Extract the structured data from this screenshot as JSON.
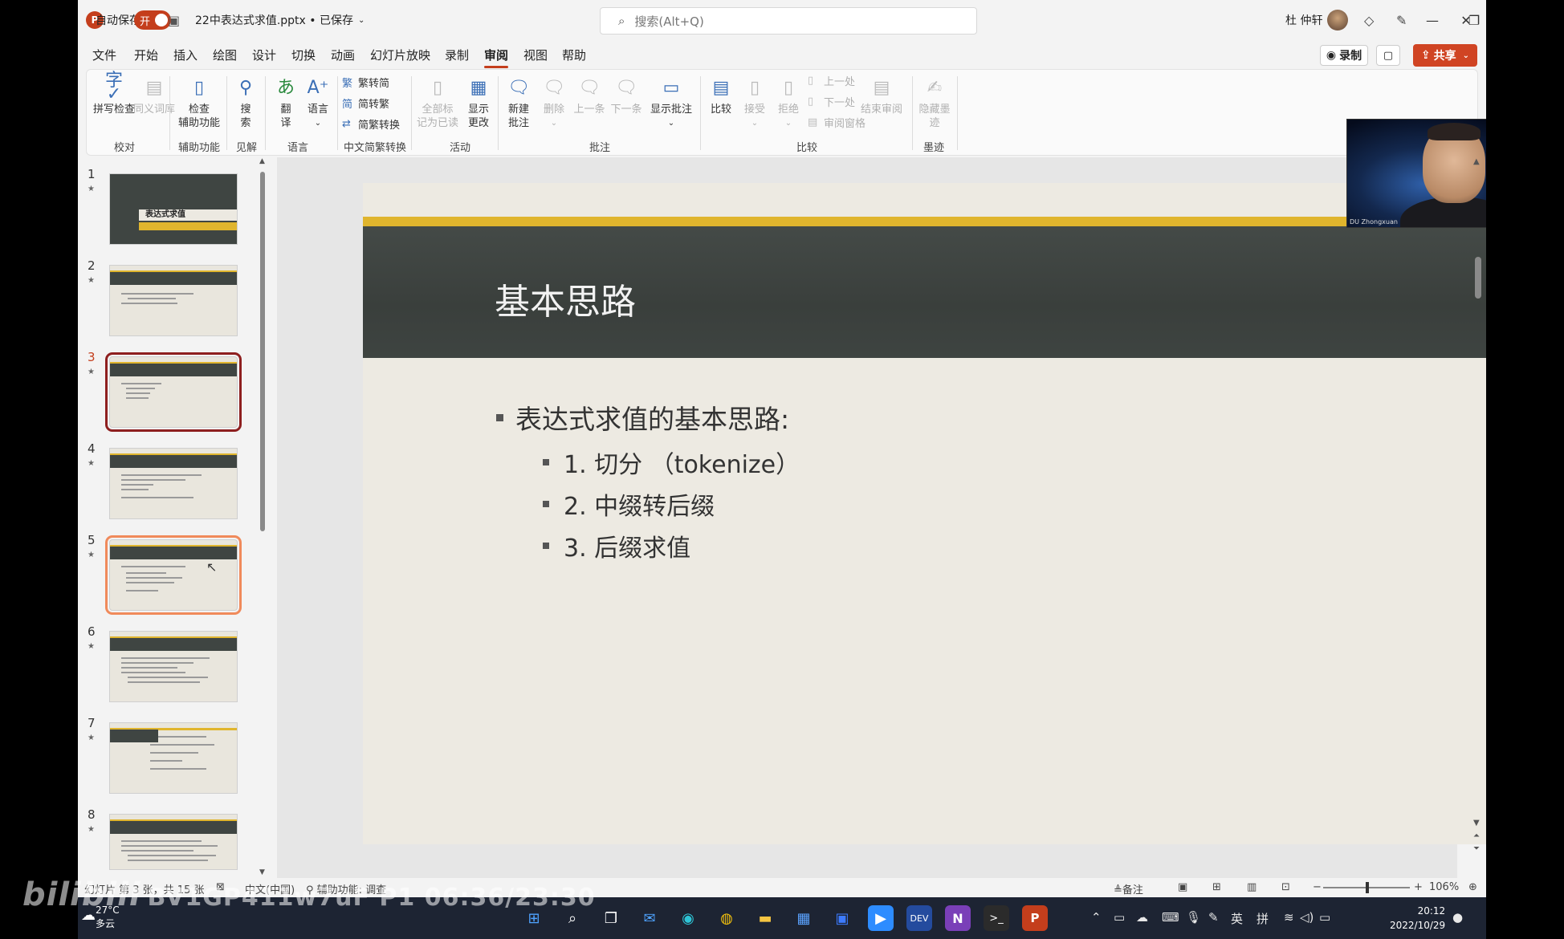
{
  "titlebar": {
    "autosave_label": "自动保存",
    "autosave_state": "开",
    "filename": "22中表达式求值.pptx • 已保存",
    "search_placeholder": "搜索(Alt+Q)",
    "user_name": "杜 仲轩"
  },
  "menu": {
    "items": [
      "文件",
      "开始",
      "插入",
      "绘图",
      "设计",
      "切换",
      "动画",
      "幻灯片放映",
      "录制",
      "审阅",
      "视图",
      "帮助"
    ],
    "active": "审阅",
    "record_label": "录制",
    "share_label": "共享"
  },
  "ribbon": {
    "spell_check": "拼写检查",
    "thesaurus": "同义词库",
    "check_access_1": "检查",
    "check_access_2": "辅助功能",
    "search_1": "搜",
    "search_2": "索",
    "translate_1": "翻",
    "translate_2": "译",
    "language": "语言",
    "trad_to_simp": "繁转简",
    "simp_to_trad": "简转繁",
    "simp_trad_convert": "简繁转换",
    "mark_read_1": "全部标",
    "mark_read_2": "记为已读",
    "show_changes_1": "显示",
    "show_changes_2": "更改",
    "new_comment_1": "新建",
    "new_comment_2": "批注",
    "delete": "删除",
    "prev_comment": "上一条",
    "next_comment": "下一条",
    "show_comments": "显示批注",
    "compare": "比较",
    "accept": "接受",
    "reject": "拒绝",
    "prev_change": "上一处",
    "next_change": "下一处",
    "review_pane": "审阅窗格",
    "end_review": "结束审阅",
    "hide_ink_1": "隐藏墨",
    "hide_ink_2": "迹",
    "groups": {
      "proofing": "校对",
      "accessibility": "辅助功能",
      "insights": "见解",
      "language": "语言",
      "chinese_conv": "中文简繁转换",
      "activity": "活动",
      "comments": "批注",
      "compare": "比较",
      "ink": "墨迹"
    }
  },
  "thumbnails": [
    {
      "num": "1",
      "title": "表达式求值"
    },
    {
      "num": "2",
      "title": ""
    },
    {
      "num": "3",
      "title": ""
    },
    {
      "num": "4",
      "title": ""
    },
    {
      "num": "5",
      "title": ""
    },
    {
      "num": "6",
      "title": ""
    },
    {
      "num": "7",
      "title": ""
    },
    {
      "num": "8",
      "title": ""
    }
  ],
  "slide": {
    "title": "基本思路",
    "bullet_main": "表达式求值的基本思路:",
    "sub_bullets": [
      "1. 切分 （tokenize）",
      "2. 中缀转后缀",
      "3. 后缀求值"
    ]
  },
  "video": {
    "name": "DU Zhongxuan"
  },
  "statusbar": {
    "slide_info": "幻灯片 第 3 张，共 15 张",
    "language": "中文(中国)",
    "accessibility": "辅助功能: 调查",
    "notes": "备注",
    "zoom": "106%"
  },
  "taskbar": {
    "temp": "27°C",
    "weather": "多云",
    "ime_lang": "英",
    "ime_mode": "拼",
    "time": "20:12",
    "date": "2022/10/29"
  },
  "watermark": {
    "logo": "bilibili",
    "text": "BV1GP411w7uF P1 06:36/23:30"
  }
}
